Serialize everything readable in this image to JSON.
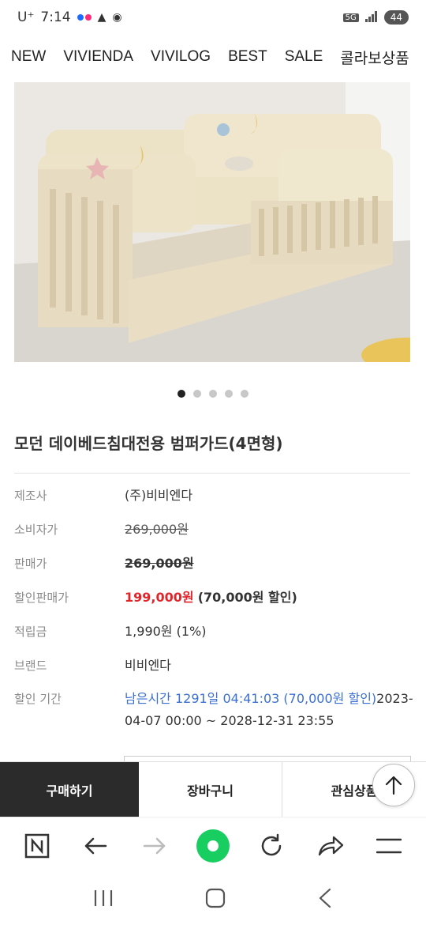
{
  "status_bar": {
    "carrier": "U⁺",
    "time": "7:14",
    "network": "5G",
    "battery": "44"
  },
  "top_nav": {
    "items": [
      "NEW",
      "VIVIENDA",
      "VIVILOG",
      "BEST",
      "SALE",
      "콜라보상품"
    ]
  },
  "carousel": {
    "page_count": 5,
    "active_index": 0
  },
  "product": {
    "title": "모던 데이베드침대전용 범퍼가드(4면형)",
    "rows": [
      {
        "label": "제조사",
        "value": "(주)비비엔다"
      },
      {
        "label": "소비자가",
        "value": "269,000원"
      },
      {
        "label": "판매가",
        "value": "269,000원"
      },
      {
        "label": "할인판매가",
        "price": "199,000원",
        "discount": "(70,000원 할인)"
      },
      {
        "label": "적립금",
        "value": "1,990원 (1%)"
      },
      {
        "label": "브랜드",
        "value": "비비엔다"
      },
      {
        "label": "할인 기간",
        "remaining": "남은시간 1291일 04:41:03 (70,000원 할인)",
        "period": "2023-04-07 00:00 ~ 2028-12-31 23:55"
      }
    ]
  },
  "actions": {
    "buy": "구매하기",
    "cart": "장바구니",
    "wish": "관심상품"
  },
  "colors": {
    "sale_price": "#e0262b",
    "countdown": "#3b6fd1",
    "buy_button_bg": "#2b2b2b"
  }
}
